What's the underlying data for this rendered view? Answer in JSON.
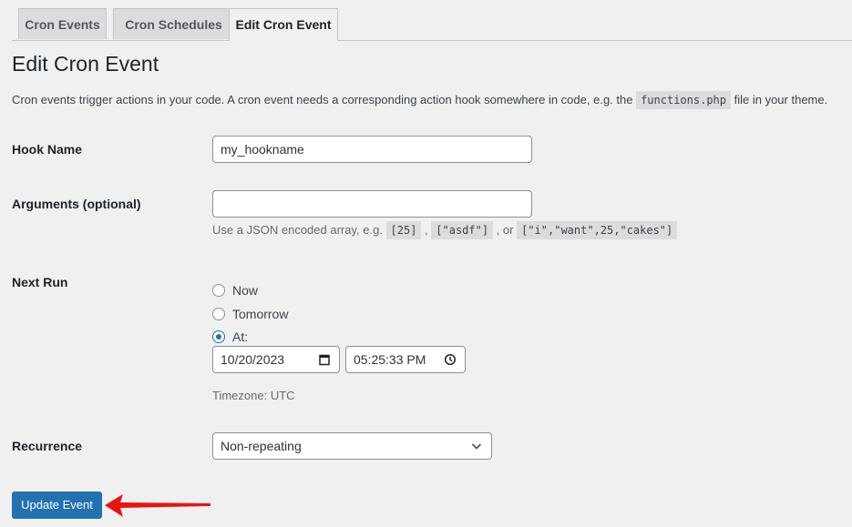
{
  "tabs": [
    {
      "label": "Cron Events",
      "active": false
    },
    {
      "label": "Cron Schedules",
      "active": false
    },
    {
      "label": "Edit Cron Event",
      "active": true
    }
  ],
  "page_title": "Edit Cron Event",
  "description": {
    "before": "Cron events trigger actions in your code. A cron event needs a corresponding action hook somewhere in code, e.g. the ",
    "code": "functions.php",
    "after": " file in your theme."
  },
  "form": {
    "hook_name": {
      "label": "Hook Name",
      "value": "my_hookname"
    },
    "arguments": {
      "label": "Arguments (optional)",
      "value": "",
      "help_prefix": "Use a JSON encoded array, e.g. ",
      "example1": "[25]",
      "sep1": " , ",
      "example2": "[\"asdf\"]",
      "sep2": " , or ",
      "example3": "[\"i\",\"want\",25,\"cakes\"]"
    },
    "next_run": {
      "label": "Next Run",
      "options": [
        {
          "label": "Now",
          "checked": false
        },
        {
          "label": "Tomorrow",
          "checked": false
        },
        {
          "label": "At:",
          "checked": true
        }
      ],
      "date": "10/20/2023",
      "time": "05:25:33 PM",
      "timezone": "Timezone: UTC"
    },
    "recurrence": {
      "label": "Recurrence",
      "selected": "Non-repeating"
    }
  },
  "submit_label": "Update Event",
  "colors": {
    "primary": "#2271b1",
    "annotation_arrow": "#e8140f"
  }
}
